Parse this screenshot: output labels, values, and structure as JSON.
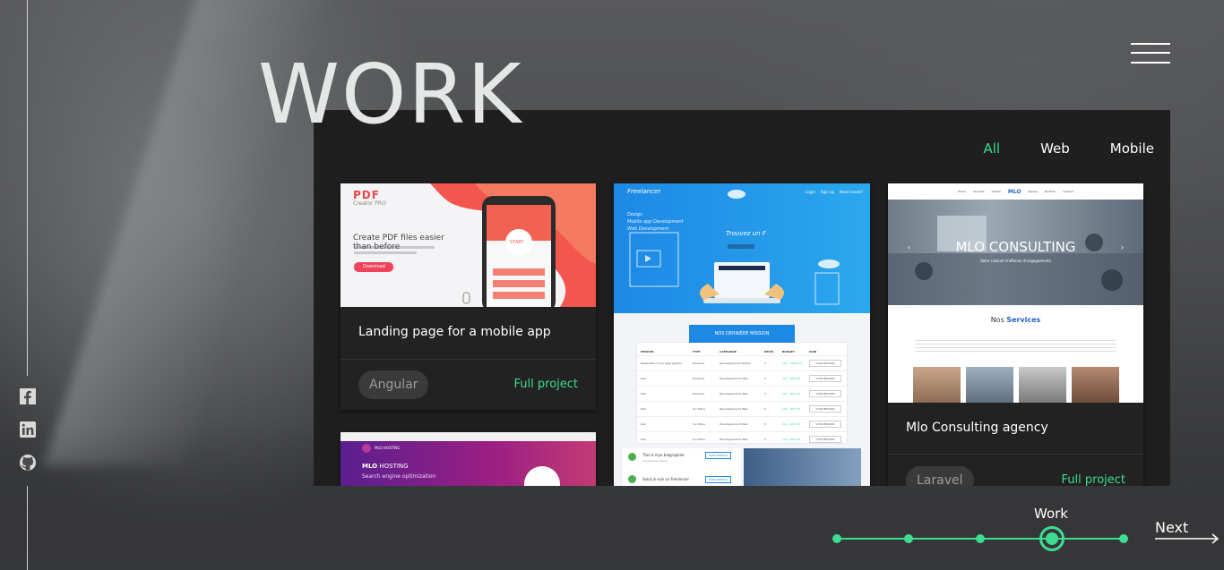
{
  "page": {
    "title": "WORK"
  },
  "filters": {
    "items": [
      "All",
      "Web",
      "Mobile"
    ],
    "active": "All"
  },
  "cards": [
    {
      "title": "Landing page for a mobile app",
      "tag": "Angular",
      "link": "Full project",
      "thumb": {
        "logo": "PDF",
        "logo_sub": "Creator PRO",
        "headline_1": "Create PDF files easier",
        "headline_2": "than before",
        "button": "Download",
        "phone_button": "START"
      }
    },
    {
      "thumb": {
        "brand": "Freelancer",
        "nav": [
          "Login",
          "Sign up",
          "Need needs?"
        ],
        "left_text_1": "Design",
        "left_text_2": "Mobile app Development",
        "left_text_3": "Web Development",
        "center_title": "Trouvez un F",
        "banner": "NOS DERNIÈRE MISSION",
        "table_headers": [
          "MISSION",
          "TYPE",
          "CATÉGORIE",
          "DEVIS",
          "BUDGET",
          "VOIR"
        ],
        "rows": [
          [
            "Réalisation d'une page gestion",
            "Distance",
            "Développement Mobile",
            "3",
            "200 - 5000 DH",
            "VOIR MISSION"
          ],
          [
            "test",
            "Distance",
            "Développement Web",
            "5",
            "397 - 800 DH",
            "VOIR MISSION"
          ],
          [
            "test",
            "Distance",
            "Développement Web",
            "5",
            "397 - 800 DH",
            "VOIR MISSION"
          ],
          [
            "test",
            "Sur Place",
            "Développement Web",
            "5",
            "200 - 800 DH",
            "VOIR MISSION"
          ],
          [
            "test",
            "Sur Place",
            "Développement Web",
            "5",
            "200 - 800 DH",
            "VOIR MISSION"
          ],
          [
            "test",
            "Sur Place",
            "Développement Web",
            "5",
            "200 - 800 DH",
            "VOIR MISSION"
          ]
        ],
        "bottom_1": "This is mya biographier",
        "bottom_1_sub": "Casablanca, Maroc",
        "bottom_2": "Salut je suis un freelancer",
        "bottom_btn": "VOIR PROFILE"
      }
    },
    {
      "title": "Mlo Consulting agency",
      "tag": "Laravel",
      "link": "Full project",
      "thumb": {
        "nav": [
          "Home",
          "Services",
          "Clients",
          "MLO",
          "Équipe",
          "Portfolio",
          "Contact"
        ],
        "hero_title": "MLO CONSULTING",
        "hero_sub": "Votre cabinet d'affaires d'engagements",
        "services_title_1": "Nos ",
        "services_title_2": "Services"
      }
    },
    {
      "thumb": {
        "brand": "MLO HOSTING",
        "title_1": "MLO",
        "title_2": " HOSTING",
        "subtitle": "Search engine optimization"
      }
    }
  ],
  "pagination": {
    "label": "Work",
    "count": 5,
    "active_index": 3
  },
  "next": {
    "label": "Next"
  },
  "social": [
    "facebook-icon",
    "linkedin-icon",
    "github-icon"
  ],
  "colors": {
    "accent": "#3ddc91",
    "panel": "#1f1f1f",
    "card": "#222222"
  }
}
